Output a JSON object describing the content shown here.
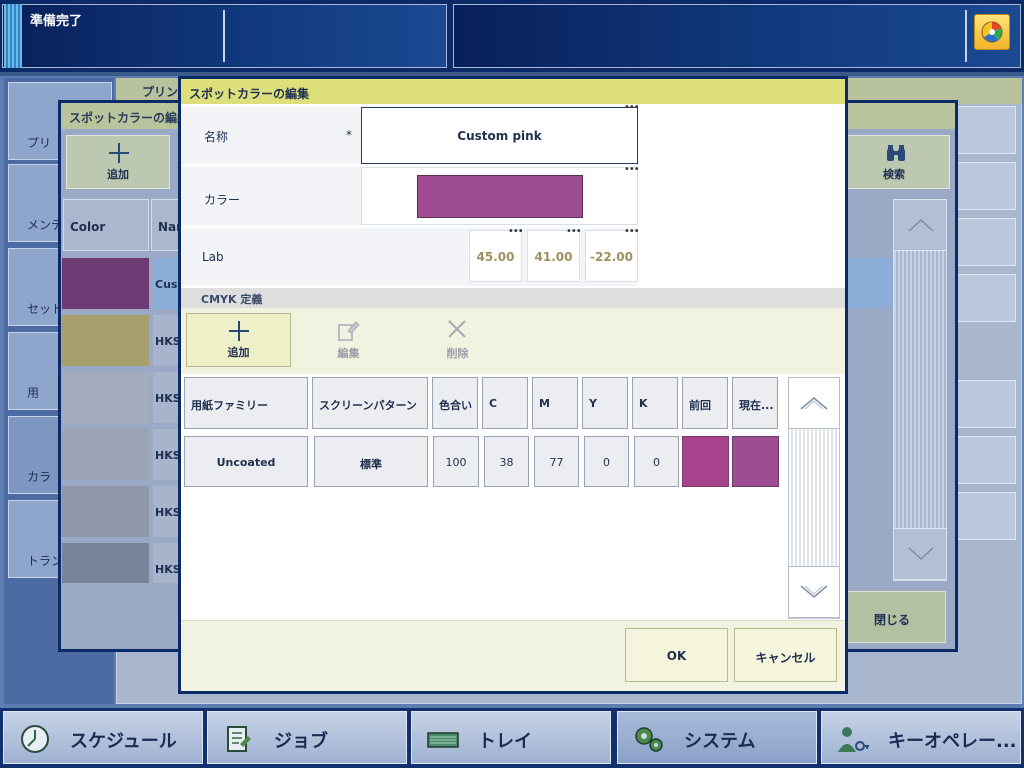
{
  "status": {
    "text": "準備完了"
  },
  "background": {
    "main_title": "プリン",
    "side_items": [
      "プリ",
      "メンテ",
      "セット",
      "用",
      "カラ",
      "トランサ"
    ]
  },
  "spot_list": {
    "title": "スポットカラーの編集",
    "add_label": "追加",
    "search_label": "検索",
    "close_label": "閉じる",
    "col_color": "Color",
    "col_name": "Nan",
    "rows": [
      {
        "label": "Cus",
        "color": "#6e3a74"
      },
      {
        "label": "HKS",
        "color": "#a69e6c"
      },
      {
        "label": "HKS",
        "color": "#a2acbc"
      },
      {
        "label": "HKS",
        "color": "#9aa4b4"
      },
      {
        "label": "HKS",
        "color": "#8e98aa"
      },
      {
        "label": "HKS",
        "color": "#7a8498"
      }
    ]
  },
  "dialog": {
    "title": "スポットカラーの編集",
    "name_label": "名称",
    "required_mark": "*",
    "name_value": "Custom pink",
    "color_label": "カラー",
    "swatch_color": "#9e4d92",
    "lab_label": "Lab",
    "lab_values": [
      "45.00",
      "41.00",
      "-22.00"
    ],
    "cmyk_section": "CMYK 定義",
    "toolbar": {
      "add": "追加",
      "edit": "編集",
      "delete": "削除"
    },
    "table": {
      "headers": [
        "用紙ファミリー",
        "スクリーンパターン",
        "色合い",
        "C",
        "M",
        "Y",
        "K",
        "前回",
        "現在..."
      ],
      "row": {
        "media_family": "Uncoated",
        "screen": "標準",
        "tint": "100",
        "c": "38",
        "m": "77",
        "y": "0",
        "k": "0",
        "previous_color": "#a8448e",
        "current_color": "#9e4d92"
      }
    },
    "ok_label": "OK",
    "cancel_label": "キャンセル"
  },
  "nav": [
    {
      "label": "スケジュール",
      "icon": "clock-icon"
    },
    {
      "label": "ジョブ",
      "icon": "document-icon"
    },
    {
      "label": "トレイ",
      "icon": "tray-icon"
    },
    {
      "label": "システム",
      "icon": "gears-icon"
    },
    {
      "label": "キーオペレー...",
      "icon": "key-operator-icon"
    }
  ]
}
